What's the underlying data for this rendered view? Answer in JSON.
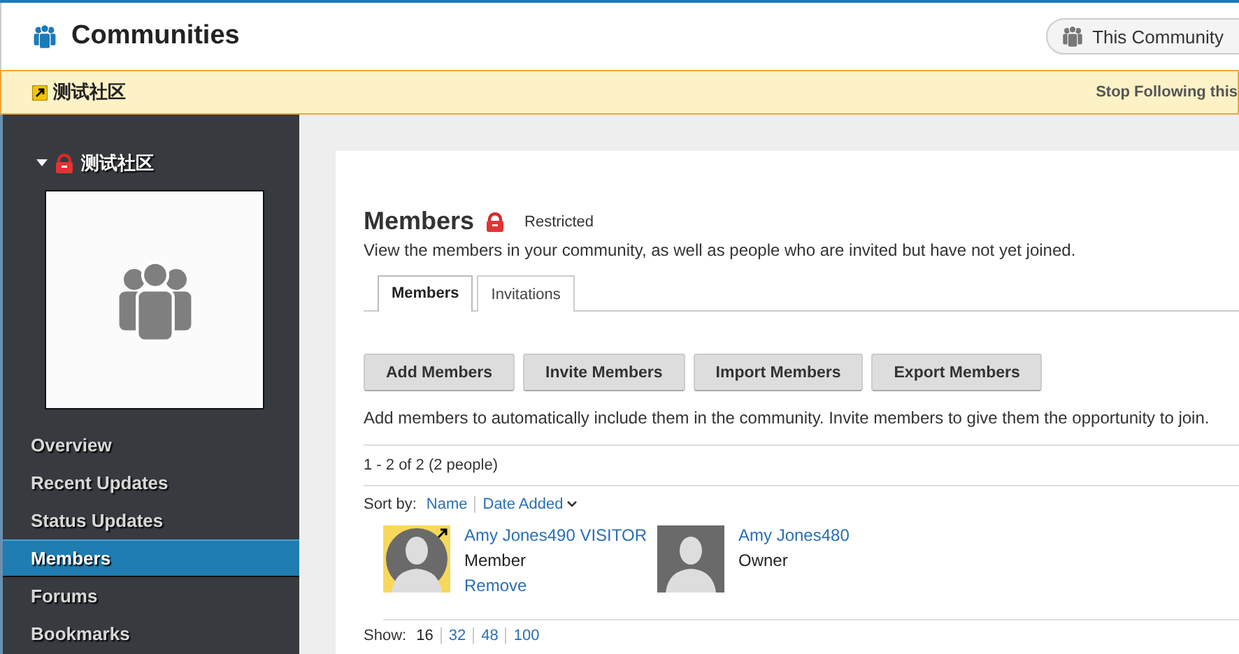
{
  "header": {
    "title": "Communities",
    "scope_button": "This Community"
  },
  "follow_bar": {
    "community_name": "测试社区",
    "action": "Stop Following this"
  },
  "sidebar": {
    "community_name": "测试社区",
    "expanded": true,
    "restricted": true,
    "items": [
      {
        "label": "Overview",
        "selected": false
      },
      {
        "label": "Recent Updates",
        "selected": false
      },
      {
        "label": "Status Updates",
        "selected": false
      },
      {
        "label": "Members",
        "selected": true
      },
      {
        "label": "Forums",
        "selected": false
      },
      {
        "label": "Bookmarks",
        "selected": false
      }
    ]
  },
  "main": {
    "title": "Members",
    "access": "Restricted",
    "description": "View the members in your community, as well as people who are invited but have not yet joined.",
    "tabs": [
      {
        "label": "Members",
        "selected": true
      },
      {
        "label": "Invitations",
        "selected": false
      }
    ],
    "buttons": [
      "Add Members",
      "Invite Members",
      "Import Members",
      "Export Members"
    ],
    "help_text": "Add members to automatically include them in the community. Invite members to give them the opportunity to join.",
    "count": "1 - 2 of 2 (2 people)",
    "sort_label": "Sort by:",
    "sort_options": [
      {
        "label": "Name",
        "selected": false
      },
      {
        "label": "Date Added",
        "selected": true
      }
    ],
    "members": [
      {
        "name": "Amy Jones490 VISITOR",
        "role": "Member",
        "external": true,
        "action": "Remove"
      },
      {
        "name": "Amy Jones480",
        "role": "Owner",
        "external": false
      }
    ],
    "show_label": "Show:",
    "page_sizes": [
      {
        "label": "16",
        "selected": true
      },
      {
        "label": "32",
        "selected": false
      },
      {
        "label": "48",
        "selected": false
      },
      {
        "label": "100",
        "selected": false
      }
    ]
  }
}
